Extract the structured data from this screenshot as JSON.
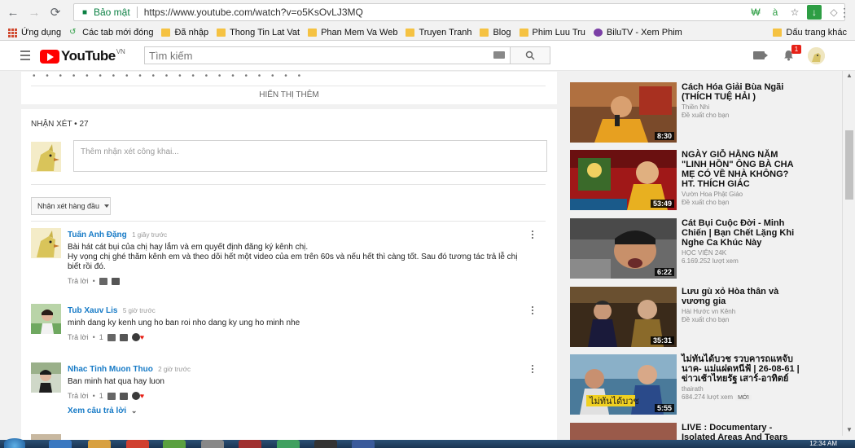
{
  "browser": {
    "secure_label": "Bảo mật",
    "url": "https://www.youtube.com/watch?v=o5KsOvLJ3MQ"
  },
  "bookmarks": [
    {
      "label": "Ứng dụng",
      "icon": "apps-icon"
    },
    {
      "label": "Các tab mới đóng",
      "icon": "history-icon"
    },
    {
      "label": "Đã nhập",
      "icon": "folder-icon"
    },
    {
      "label": "Thong Tin Lat Vat",
      "icon": "folder-icon"
    },
    {
      "label": "Phan Mem Va Web",
      "icon": "folder-icon"
    },
    {
      "label": "Truyen Tranh",
      "icon": "folder-icon"
    },
    {
      "label": "Blog",
      "icon": "folder-icon"
    },
    {
      "label": "Phim Luu Tru",
      "icon": "folder-icon"
    },
    {
      "label": "BiluTV - Xem Phim",
      "icon": "site-icon"
    },
    {
      "label": "Dấu trang khác",
      "icon": "folder-icon"
    }
  ],
  "youtube": {
    "logo_text": "YouTube",
    "country": "VN",
    "search_placeholder": "Tìm kiếm",
    "notification_count": "1"
  },
  "description": {
    "show_more": "HIỂN THỊ THÊM"
  },
  "comments": {
    "header": "NHẬN XÉT • 27",
    "input_placeholder": "Thêm nhận xét công khai...",
    "sort_label": "Nhận xét hàng đầu",
    "items": [
      {
        "author": "Tuấn Anh Đặng",
        "time": "1 giây trước",
        "text": "Bài hát cát bụi của chị hay lắm và em quyết định đăng ký kênh chị.\nHy vọng chị ghé thăm kênh em và theo dõi hết một video của em trên 60s và nếu hết thì càng tốt. Sau đó tương tác trả lễ chị biết rồi đó.",
        "reply": "Trả lời",
        "likes": ""
      },
      {
        "author": "Tub Xauv Lis",
        "time": "5 giờ trước",
        "text": "minh dang ky kenh ung ho ban roi nho dang ky ung ho minh nhe",
        "reply": "Trả lời",
        "likes": "1"
      },
      {
        "author": "Nhac Tinh Muon Thuo",
        "time": "2 giờ trước",
        "text": "Ban minh hat qua hay luon",
        "reply": "Trả lời",
        "likes": "1",
        "view_replies": "Xem câu trả lời"
      }
    ]
  },
  "recommendations": [
    {
      "title": "Cách Hóa Giải Bùa Ngãi (THÍCH TUỆ HẢI )",
      "channel": "Thiền Nhi",
      "meta": "Đề xuất cho bạn",
      "duration": "8:30"
    },
    {
      "title": "NGÀY GIỖ HẰNG NĂM \"LINH HỒN\" ÔNG BÀ CHA MẸ CÓ VỀ NHÀ KHÔNG? HT. THÍCH GIÁC",
      "channel": "Vườn Hoa Phật Giáo",
      "meta": "Đề xuất cho bạn",
      "duration": "53:49"
    },
    {
      "title": "Cát Bụi Cuộc Đời - Minh Chiến | Bạn Chết Lặng Khi Nghe Ca Khúc Này",
      "channel": "HỌC VIỆN 24K",
      "meta": "6.169.252 lượt xem",
      "duration": "6:22"
    },
    {
      "title": "Lưu gù xỏ Hòa thân và vương gia",
      "channel": "Hài Hước vn Kênh",
      "meta": "Đề xuất cho bạn",
      "duration": "35:31"
    },
    {
      "title": "ไม่ทันได้บวช รวบคารถแหจับนาค- แม่แฝดหนีฟ้ | 26-08-61 | ข่าวเช้าไทยรัฐ เสาร์-อาทิตย์",
      "channel": "thairath",
      "meta": "684.274 lượt xem",
      "duration": "5:55",
      "badge": "MỚI"
    },
    {
      "title": "LIVE : Documentary - Isolated Areas And Tears Girls In",
      "channel": "",
      "meta": "",
      "duration": ""
    }
  ],
  "taskbar": {
    "clock": "12:34 AM"
  }
}
